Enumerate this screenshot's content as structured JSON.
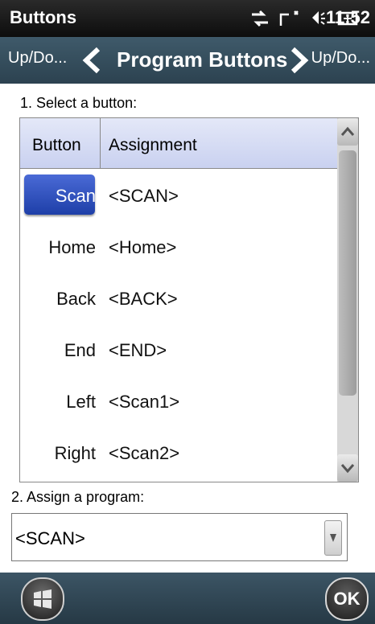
{
  "status_bar": {
    "title": "Buttons",
    "time": "11:52",
    "icons": [
      "connectivity-icon",
      "signal-icon",
      "volume-icon",
      "battery-icon"
    ]
  },
  "nav": {
    "left_label": "Up/Do...",
    "title": "Program Buttons",
    "right_label": "Up/Do..."
  },
  "section1_label": "1. Select a button:",
  "table": {
    "headers": [
      "Button",
      "Assignment"
    ],
    "rows": [
      {
        "button": "Scan",
        "assignment": "<SCAN>",
        "selected": true
      },
      {
        "button": "Home",
        "assignment": "<Home>"
      },
      {
        "button": "Back",
        "assignment": "<BACK>"
      },
      {
        "button": "End",
        "assignment": "<END>"
      },
      {
        "button": "Left",
        "assignment": "<Scan1>"
      },
      {
        "button": "Right",
        "assignment": "<Scan2>"
      }
    ]
  },
  "section2_label": "2. Assign a program:",
  "program_select": {
    "value": "<SCAN>"
  },
  "bottom_bar": {
    "ok_label": "OK"
  },
  "colors": {
    "selected_row": "#2f50c0",
    "nav_bar": "#34505f"
  }
}
